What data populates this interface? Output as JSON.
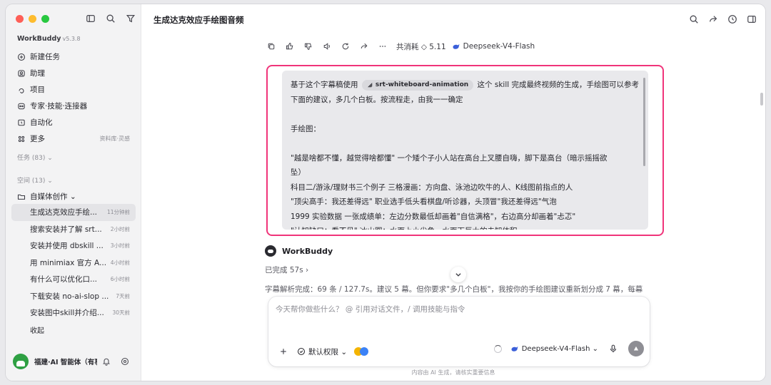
{
  "app": {
    "name": "WorkBuddy",
    "version": "v5.3.8"
  },
  "sidebar": {
    "nav": [
      {
        "label": "新建任务",
        "icon": "plus-circle-icon"
      },
      {
        "label": "助理",
        "icon": "assistant-icon"
      },
      {
        "label": "项目",
        "icon": "project-icon"
      },
      {
        "label": "专家·技能·连接器",
        "icon": "expert-icon"
      },
      {
        "label": "自动化",
        "icon": "alarm-icon"
      },
      {
        "label": "更多",
        "icon": "grid-icon",
        "right": "资料库·灵感"
      }
    ],
    "tasks_label": "任务 (83) ⌄",
    "spaces_label": "空间 (13) ⌄",
    "folder": "自媒体创作 ⌄",
    "items": [
      {
        "title": "生成达克效应手绘...",
        "time": "11分钟前"
      },
      {
        "title": "搜索安装并了解 srt...",
        "time": "2小时前"
      },
      {
        "title": "安装并使用 dbskill ...",
        "time": "3小时前"
      },
      {
        "title": "用 minimiax 官方 A...",
        "time": "4小时前"
      },
      {
        "title": "有什么可以优化口...",
        "time": "6小时前"
      },
      {
        "title": "下载安装 no-ai-slop ...",
        "time": "7天前"
      },
      {
        "title": "安装图中skill并介绍...",
        "time": "30天前"
      }
    ],
    "collapse": "收起",
    "footer_name": "福建·AI 智能体（有事"
  },
  "header": {
    "title": "生成达克效应手绘图音频"
  },
  "message_actions": {
    "cost": "共消耗 ◇ 5.11",
    "model": "Deepseek-V4-Flash"
  },
  "user_message": {
    "lines": [
      {
        "pre": "基于这个字幕稿使用",
        "chip": "srt-whiteboard-animation",
        "post": "这个 skill 完成最终视频的生成，手绘图可以参考"
      },
      {
        "text": "下面的建议，多几个白板。按流程走，由我一一确定"
      },
      {
        "text": ""
      },
      {
        "text": "手绘图："
      },
      {
        "text": ""
      },
      {
        "text": "\"越是啥都不懂，越觉得啥都懂\"      一个矮个子小人站在高台上叉腰自嗨，脚下是高台（暗示摇摇欲"
      },
      {
        "text": "坠）"
      },
      {
        "text": "科目二/游泳/理财书三个例子    三格漫画：方向盘、泳池边吹牛的人、K线图前指点的人"
      },
      {
        "text": "\"顶尖高手：我还差得远\" 职业选手低头看棋盘/听诊器，头顶冒\"我还差得远\"气泡"
      },
      {
        "text": "1999 实验数据 一张成绩单：左边分数最低却画着\"自信满格\"，右边高分却画着\"忐忑\""
      },
      {
        "text": "\"认知缺口：看不见\"         冰山图：水面上小尖角，水面下巨大的未知体积"
      }
    ]
  },
  "bot": {
    "name": "WorkBuddy",
    "status": "已完成 57s ›",
    "preview": "字幕解析完成：69 条 / 127.7s。建议 5 幕。但你要求\"多几个白板\"，我按你的手绘图建议重新划分成 7 幕，每幕"
  },
  "composer": {
    "placeholder": "今天帮你做些什么？ @ 引用对话文件，/ 调用技能与指令",
    "value": "",
    "permission": "默认权限 ⌄",
    "model": "Deepseek-V4-Flash ⌄"
  },
  "disclaimer": "内容由 AI 生成，请核实重要信息"
}
